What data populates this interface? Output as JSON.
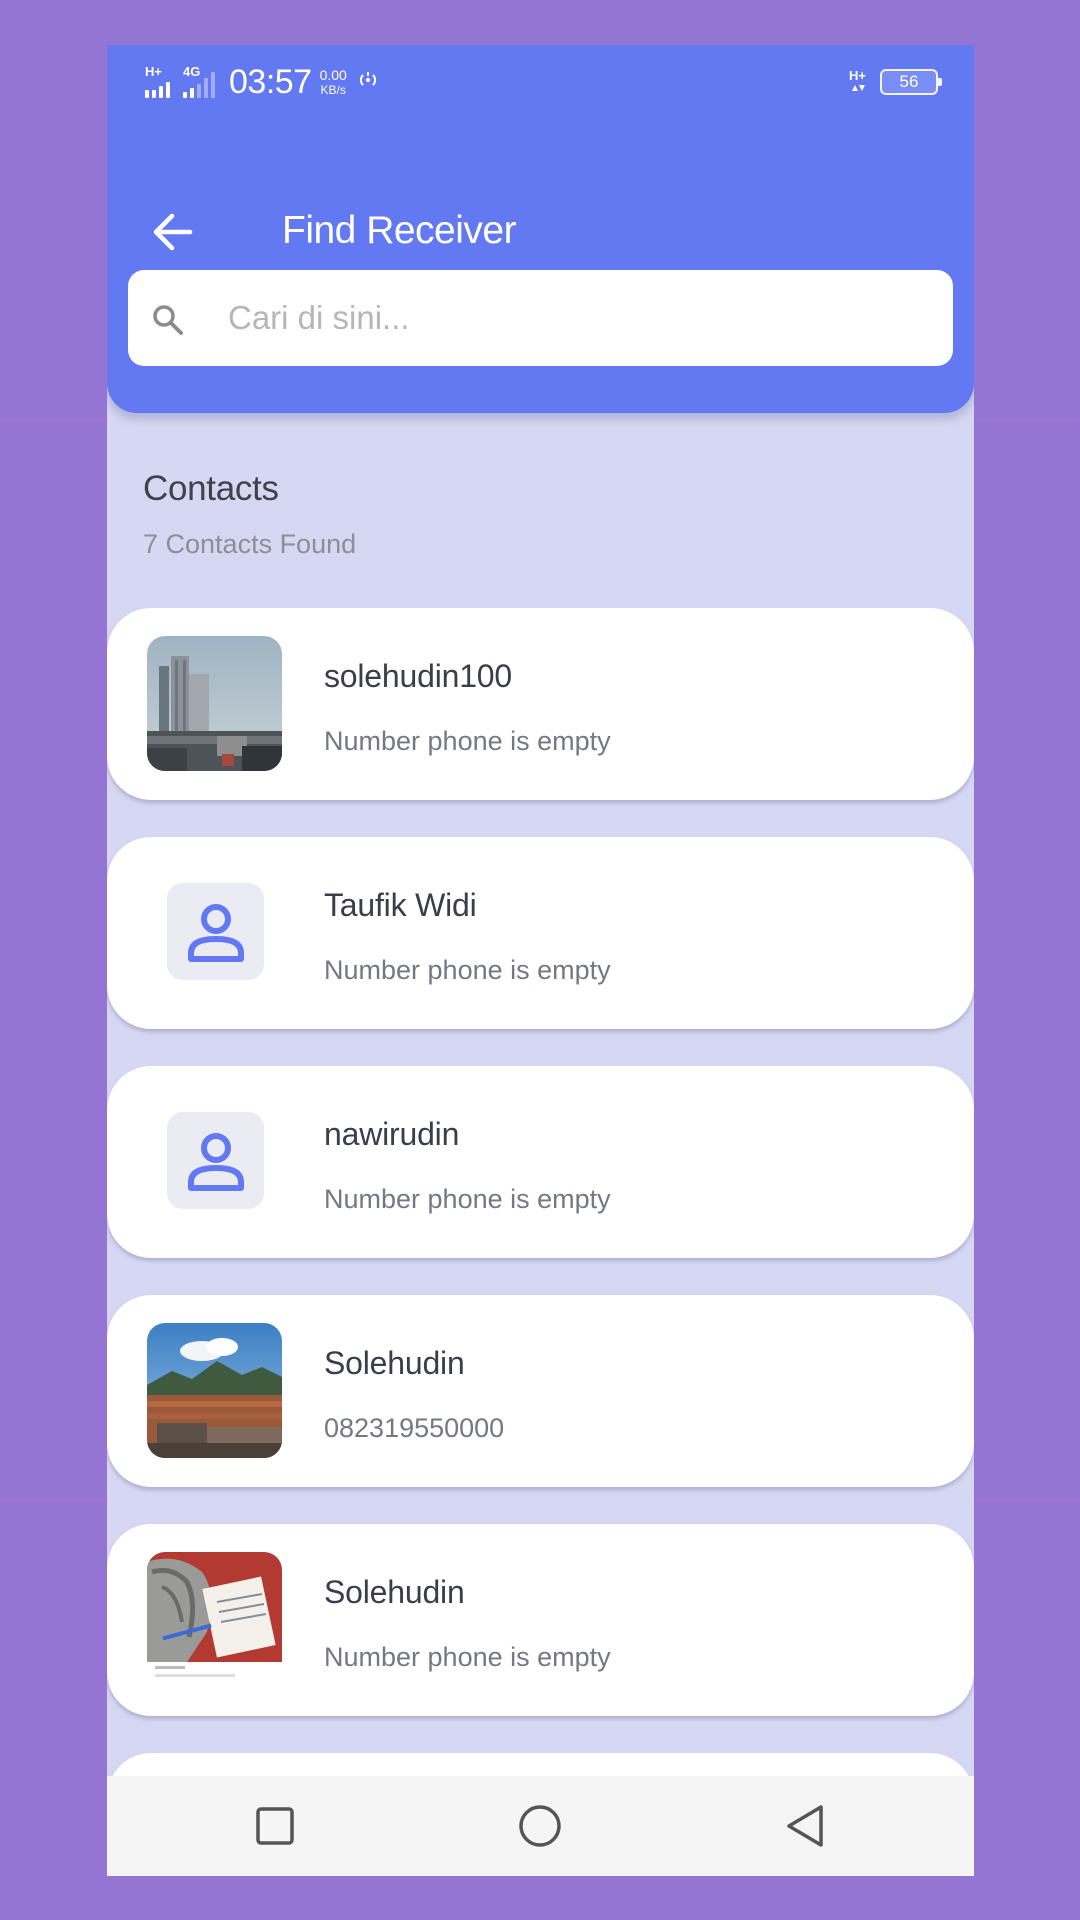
{
  "status_bar": {
    "left_signal_1_tag": "H+",
    "left_signal_2_tag": "4G",
    "time": "03:57",
    "net_speed_value": "0.00",
    "net_speed_unit": "KB/s",
    "right_signal_tag": "H+",
    "battery_level": "56"
  },
  "header": {
    "title": "Find Receiver",
    "back_icon": "arrow-left-icon"
  },
  "search": {
    "placeholder": "Cari di sini...",
    "value": "",
    "icon": "search-icon"
  },
  "contacts_section": {
    "title": "Contacts",
    "count_text": "7 Contacts Found"
  },
  "contacts": [
    {
      "name": "solehudin100",
      "phone": "Number phone is empty",
      "avatar": "photo-building"
    },
    {
      "name": "Taufik Widi",
      "phone": "Number phone is empty",
      "avatar": "person-icon"
    },
    {
      "name": "nawirudin",
      "phone": "Number phone is empty",
      "avatar": "person-icon"
    },
    {
      "name": "Solehudin",
      "phone": "082319550000",
      "avatar": "photo-landscape"
    },
    {
      "name": "Solehudin",
      "phone": "Number phone is empty",
      "avatar": "photo-cat"
    }
  ],
  "nav_bar": {
    "recent_icon": "square-icon",
    "home_icon": "circle-icon",
    "back_icon": "triangle-back-icon"
  },
  "colors": {
    "primary": "#6379f2",
    "background": "#d6d8f3",
    "page_background": "#9575d4",
    "card": "#ffffff",
    "text_primary": "#3c3d4a",
    "text_secondary": "#767785"
  }
}
